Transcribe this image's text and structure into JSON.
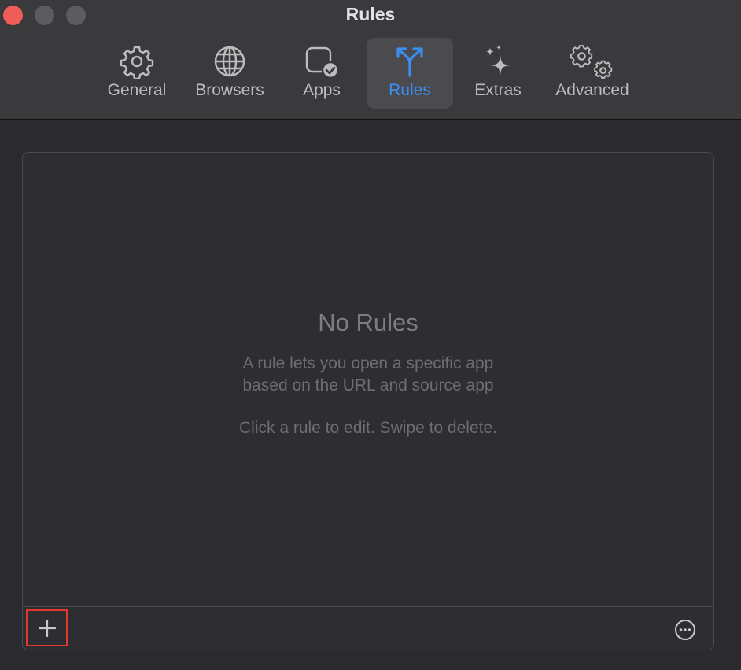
{
  "window": {
    "title": "Rules"
  },
  "toolbar": {
    "tabs": [
      {
        "label": "General",
        "icon": "gear-icon"
      },
      {
        "label": "Browsers",
        "icon": "globe-icon"
      },
      {
        "label": "Apps",
        "icon": "app-check-icon"
      },
      {
        "label": "Rules",
        "icon": "branch-icon",
        "selected": true
      },
      {
        "label": "Extras",
        "icon": "sparkles-icon"
      },
      {
        "label": "Advanced",
        "icon": "gears-icon"
      }
    ]
  },
  "empty_state": {
    "title": "No Rules",
    "description_line1": "A rule lets you open a specific app",
    "description_line2": "based on the URL and source app",
    "hint": "Click a rule to edit. Swipe to delete."
  },
  "bottom_bar": {
    "add_icon": "plus-icon",
    "more_icon": "ellipsis-circle-icon"
  },
  "colors": {
    "accent": "#3b8ff0",
    "close": "#ee5d58",
    "highlight_box": "#e13a2d"
  }
}
